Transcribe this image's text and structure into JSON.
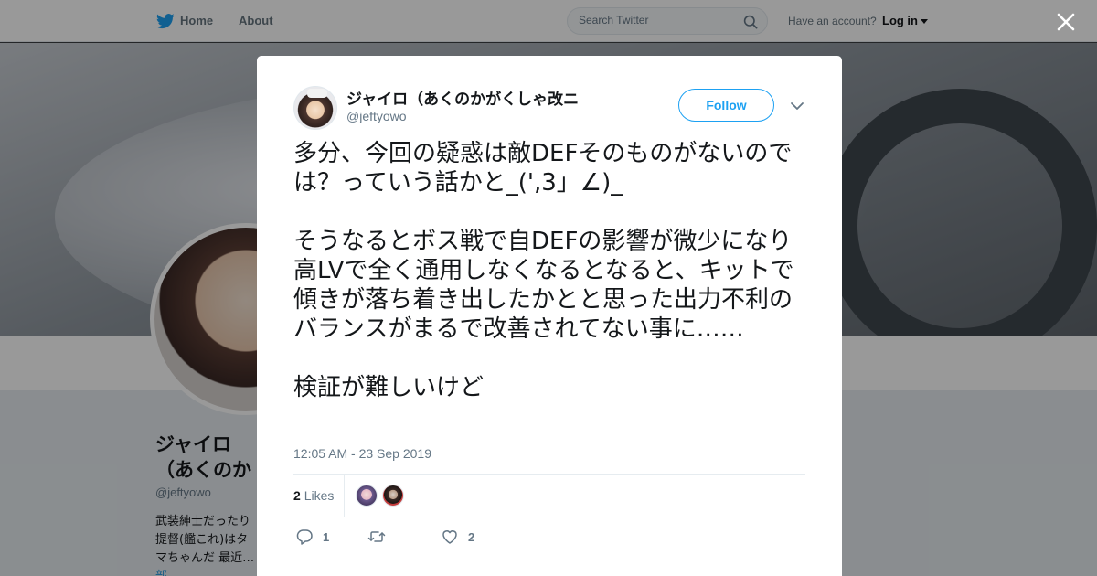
{
  "topbar": {
    "home_label": "Home",
    "about_label": "About",
    "search_placeholder": "Search Twitter",
    "have_account": "Have an account?",
    "login_label": "Log in"
  },
  "profile": {
    "name": "ジャイロ（あくのかがくしゃ改ニ",
    "handle": "@jeftyowo",
    "bio": "武装紳士だったり提督(艦これ)はタマちゃんだ 最近…",
    "bio_link": "部"
  },
  "tweet": {
    "display_name": "ジャイロ（あくのかがくしゃ改ニ",
    "handle": "@jeftyowo",
    "follow_label": "Follow",
    "paragraphs": [
      "多分、今回の疑惑は敵DEFそのものがないのでは？っていう話かと_(',3」∠)_",
      "そうなるとボス戦で自DEFの影響が微少になり高LVで全く通用しなくなるとなると、キットで傾きが落ち着き出したかとと思った出力不利のバランスがまるで改善されてない事に……",
      "検証が難しいけど"
    ],
    "timestamp": "12:05 AM - 23 Sep 2019",
    "likes_count": "2",
    "likes_label": "Likes",
    "reply_count": "1",
    "retweet_count": "",
    "like_count": "2"
  },
  "colors": {
    "accent": "#1da1f2",
    "text": "#14171a",
    "muted": "#657786"
  },
  "icons": {
    "logo": "twitter-bird-icon",
    "search": "search-icon",
    "close": "close-icon",
    "caret": "chevron-down-icon",
    "reply": "reply-icon",
    "retweet": "retweet-icon",
    "like": "heart-icon"
  }
}
